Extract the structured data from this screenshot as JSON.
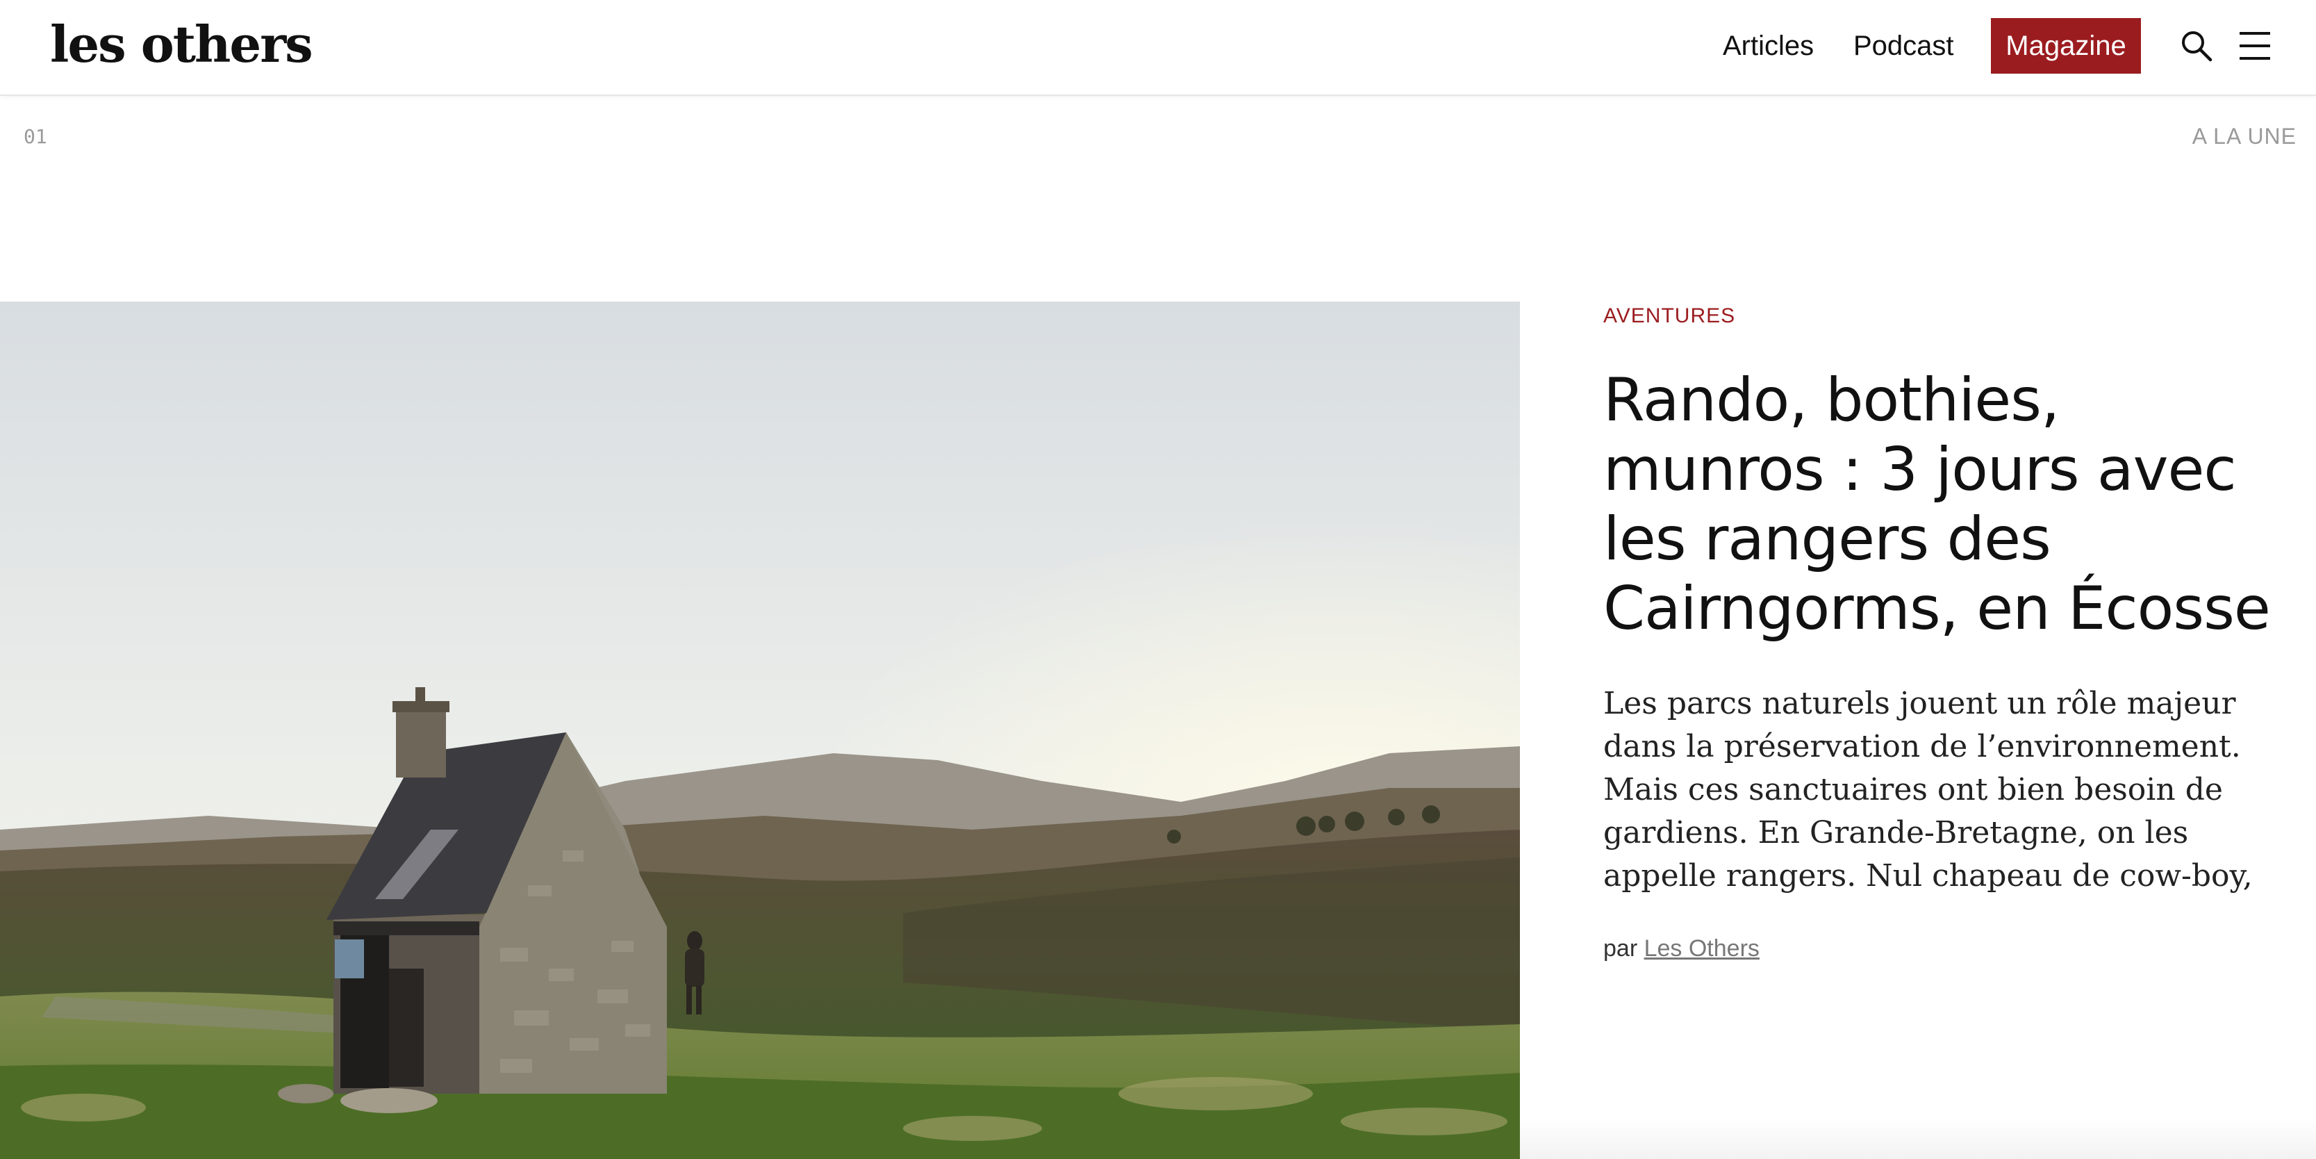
{
  "header": {
    "logo": "les others",
    "nav": {
      "articles": "Articles",
      "podcast": "Podcast",
      "magazine": "Magazine"
    },
    "icons": {
      "search": "search-icon",
      "menu": "hamburger-menu-icon"
    },
    "accent_color": "#9b1c1f"
  },
  "section": {
    "number": "01",
    "label": "A LA UNE"
  },
  "article": {
    "category": "AVENTURES",
    "headline": "Rando, bothies, munros : 3 jours avec les rangers des Cairngorms, en Écosse",
    "excerpt": "Les parcs naturels jouent un rôle majeur dans la préservation de l’environnement. Mais ces sanctuaires ont bien besoin de gardiens. En Grande-Bretagne, on les appelle rangers. Nul chapeau de cow-boy, cheval ou",
    "byline_prefix": "par",
    "author": "Les Others"
  }
}
